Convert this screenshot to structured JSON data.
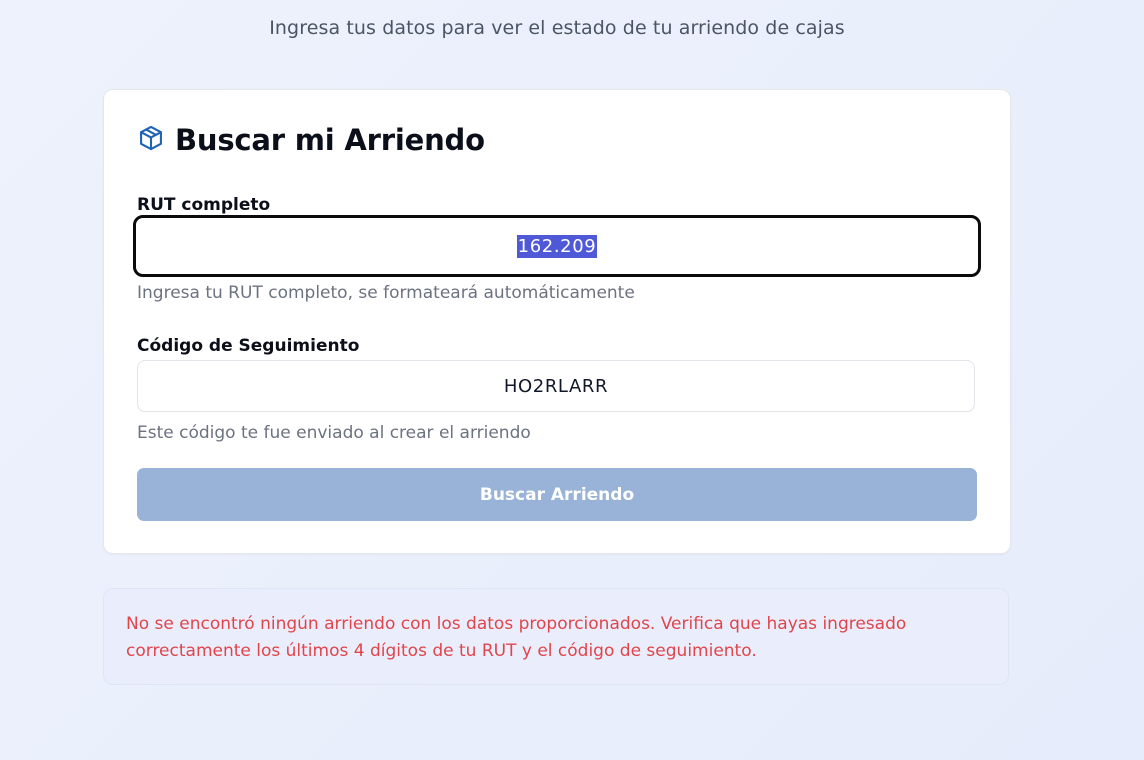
{
  "header": {
    "subtitle": "Ingresa tus datos para ver el estado de tu arriendo de cajas"
  },
  "card": {
    "title": "Buscar mi Arriendo",
    "icon": "package-icon",
    "rut": {
      "label": "RUT completo",
      "value": "162.209",
      "hint": "Ingresa tu RUT completo, se formateará automáticamente"
    },
    "tracking": {
      "label": "Código de Seguimiento",
      "value": "HO2RLARR",
      "hint": "Este código te fue enviado al crear el arriendo"
    },
    "submit_label": "Buscar Arriendo"
  },
  "error": {
    "message_line1": "No se encontró ningún arriendo con los datos proporcionados. Verifica que hayas ingresado",
    "message_line2": "correctamente los últimos 4 dígitos de tu RUT y el código de seguimiento."
  },
  "colors": {
    "accent_icon": "#1e63b6",
    "button_disabled": "#98b3d7",
    "error_text": "#e0454b",
    "selection": "#4f58d6"
  }
}
